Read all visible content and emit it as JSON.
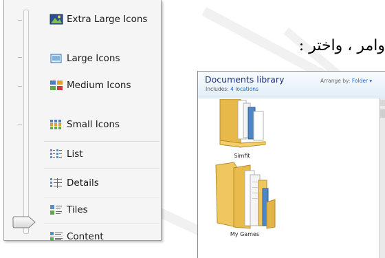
{
  "view_menu": {
    "items": [
      {
        "label": "Extra Large Icons",
        "icon": "extra-large-icons-icon"
      },
      {
        "label": "Large Icons",
        "icon": "large-icons-icon"
      },
      {
        "label": "Medium Icons",
        "icon": "medium-icons-icon"
      },
      {
        "label": "Small Icons",
        "icon": "small-icons-icon"
      },
      {
        "label": "List",
        "icon": "list-icon"
      },
      {
        "label": "Details",
        "icon": "details-icon"
      },
      {
        "label": "Tiles",
        "icon": "tiles-icon"
      },
      {
        "label": "Content",
        "icon": "content-icon"
      }
    ],
    "selected": "Medium Icons"
  },
  "arabic_text": "وامر ، واختر :",
  "library": {
    "title": "Documents library",
    "includes_prefix": "Includes:",
    "includes_link": "4 locations",
    "arrange_prefix": "Arrange by:",
    "arrange_value": "Folder ▾",
    "folders": [
      {
        "label": "Simfit"
      },
      {
        "label": "My Games"
      }
    ]
  },
  "colors": {
    "menu_bg": "#f5f5f5",
    "library_title": "#1e3287",
    "link": "#2266cc",
    "folder": "#f0c75e"
  }
}
